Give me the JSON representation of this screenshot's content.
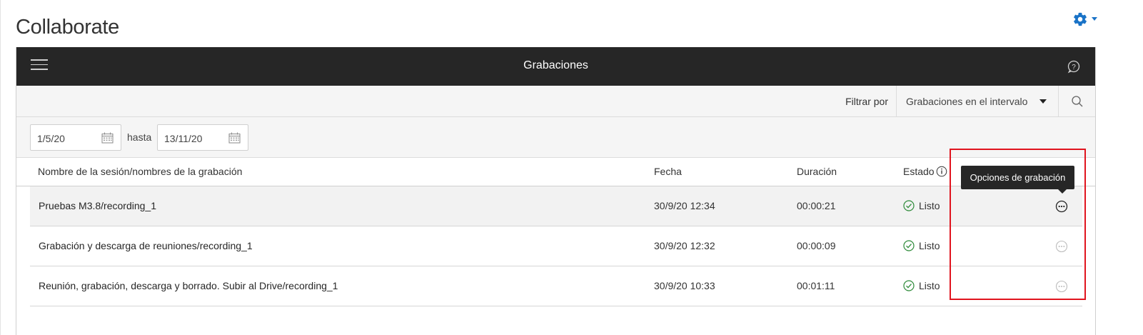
{
  "app": {
    "title": "Collaborate"
  },
  "topbar": {
    "title": "Grabaciones"
  },
  "filter": {
    "label": "Filtrar por",
    "selected": "Grabaciones en el intervalo"
  },
  "date_range": {
    "from": "1/5/20",
    "separator": "hasta",
    "to": "13/11/20"
  },
  "table": {
    "headers": {
      "name": "Nombre de la sesión/nombres de la grabación",
      "fecha": "Fecha",
      "duracion": "Duración",
      "estado": "Estado"
    },
    "rows": [
      {
        "name": "Pruebas M3.8/recording_1",
        "fecha": "30/9/20 12:34",
        "duracion": "00:00:21",
        "estado": "Listo"
      },
      {
        "name": "Grabación y descarga de reuniones/recording_1",
        "fecha": "30/9/20 12:32",
        "duracion": "00:00:09",
        "estado": "Listo"
      },
      {
        "name": "Reunión, grabación, descarga y borrado. Subir al Drive/recording_1",
        "fecha": "30/9/20 10:33",
        "duracion": "00:01:11",
        "estado": "Listo"
      }
    ]
  },
  "tooltip": {
    "text": "Opciones de grabación"
  },
  "colors": {
    "accent": "#1a73c7",
    "topbar": "#262626",
    "status_ok": "#2e8b3a",
    "highlight_box": "#e0141e"
  },
  "icons": [
    "gear-icon",
    "caret-down-icon",
    "hamburger-menu-icon",
    "help-icon",
    "search-icon",
    "calendar-icon",
    "info-icon",
    "check-circle-icon",
    "more-options-icon"
  ]
}
